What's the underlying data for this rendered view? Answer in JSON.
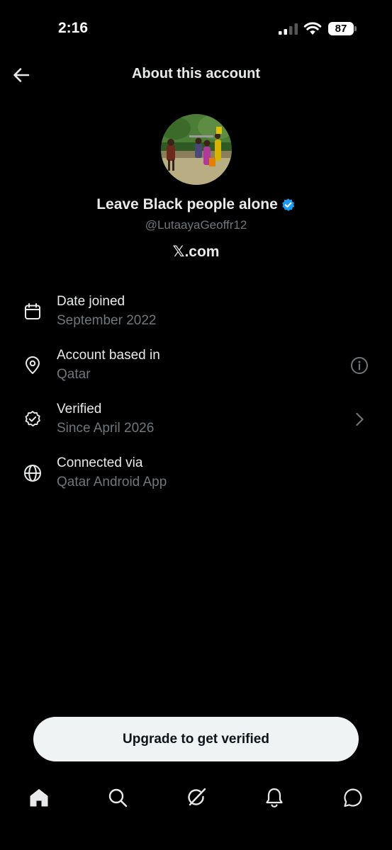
{
  "status_bar": {
    "time": "2:16",
    "battery": "87"
  },
  "header": {
    "title": "About this account",
    "back_icon": "arrow-left-icon"
  },
  "profile": {
    "name": "Leave Black people alone",
    "handle": "@LutaayaGeoffr12",
    "site": "𝕏.com",
    "verified_badge_color": "#1d9bf0"
  },
  "info": {
    "date_joined": {
      "label": "Date joined",
      "value": "September 2022",
      "icon": "calendar-icon"
    },
    "account_based": {
      "label": "Account based in",
      "value": "Qatar",
      "icon": "location-pin-icon",
      "action_icon": "info-circle-icon"
    },
    "verified": {
      "label": "Verified",
      "value": "Since April 2026",
      "icon": "verified-seal-icon",
      "action_icon": "chevron-right-icon"
    },
    "connected": {
      "label": "Connected via",
      "value": "Qatar Android App",
      "icon": "globe-icon"
    }
  },
  "upgrade_button": {
    "label": "Upgrade to get verified"
  },
  "bottom_nav": {
    "items": [
      "home-icon",
      "search-icon",
      "grok-icon",
      "notifications-bell-icon",
      "messages-icon"
    ]
  },
  "colors": {
    "background": "#000000",
    "primary_text": "#e7e9ea",
    "secondary_text": "#71767b",
    "button_bg": "#eff3f4",
    "accent": "#1d9bf0"
  }
}
